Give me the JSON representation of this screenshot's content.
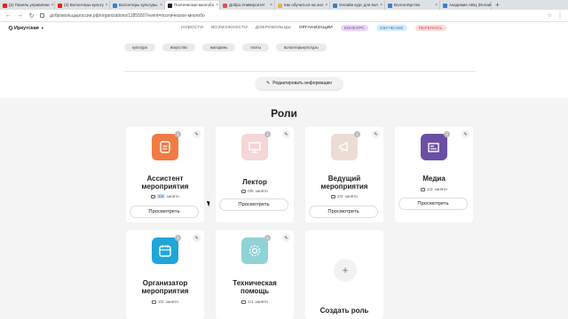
{
  "browser": {
    "tabs": [
      {
        "title": "(2) Панель управлени",
        "color": "#e62117"
      },
      {
        "title": "(2) Волонтеры-культу",
        "color": "#e62117"
      },
      {
        "title": "Волонтеры культуры",
        "color": "#3b7fc4"
      },
      {
        "title": "Поэтическое многобо",
        "color": "#222222",
        "active": true
      },
      {
        "title": "Добро.Университет",
        "color": "#d9534f"
      },
      {
        "title": "Как обучаться на онл",
        "color": "#e2b93b"
      },
      {
        "title": "Онлайн курс для вол",
        "color": "#3b7fc4"
      },
      {
        "title": "Волонтёрство",
        "color": "#3b7fc4"
      },
      {
        "title": "Академия АВЦ |Онлай",
        "color": "#3b7fc4"
      }
    ],
    "url": "добровольцыроссии.рф/organizations/11855507event=поэтическое-многобо"
  },
  "header": {
    "region": "Иркутская",
    "nav": [
      "НОВОСТИ",
      "ВОЗМОЖНОСТИ",
      "ДОБРОВОЛЬЦЫ",
      "ОРГАНИЗАЦИИ"
    ],
    "konkurs": "КОНКУРС",
    "obuchenie": "ОБУЧЕНИЕ",
    "perepis": "ПЕРЕПИСЬ"
  },
  "tags": [
    "культура",
    "искусство",
    "молодежь",
    "поэты",
    "волонтерыкультуры"
  ],
  "edit_info_label": "Редактировать информацию",
  "roles_title": "Роли",
  "roles": [
    {
      "title_lines": [
        "Ассистент",
        "мероприятия"
      ],
      "occupied": "1/4",
      "occupied_suffix": "занято",
      "icon": "clipboard-icon",
      "color": "#f07b45",
      "view": "Просмотреть"
    },
    {
      "title_lines": [
        "Лектор"
      ],
      "occupied": "0/5",
      "occupied_suffix": "занято",
      "icon": "presentation-icon",
      "color": "#f6d6d6",
      "view": "Просмотреть"
    },
    {
      "title_lines": [
        "Ведущий",
        "мероприятия"
      ],
      "occupied": "2/2",
      "occupied_suffix": "занято",
      "icon": "megaphone-icon",
      "color": "#ecdcd6",
      "view": "Просмотреть"
    },
    {
      "title_lines": [
        "Медиа"
      ],
      "occupied": "1/2",
      "occupied_suffix": "занято",
      "icon": "newspaper-icon",
      "color": "#6a4fa3",
      "view": "Просмотреть"
    },
    {
      "title_lines": [
        "Организатор",
        "мероприятия"
      ],
      "occupied": "2/2",
      "occupied_suffix": "занято",
      "icon": "calendar-icon",
      "color": "#1fa6d8",
      "view": ""
    },
    {
      "title_lines": [
        "Техническая",
        "помощь"
      ],
      "occupied": "1/1",
      "occupied_suffix": "занято",
      "icon": "gear-icon",
      "color": "#8fd3d6",
      "view": ""
    }
  ],
  "create_role_label": "Создать роль",
  "badge_text": "i"
}
